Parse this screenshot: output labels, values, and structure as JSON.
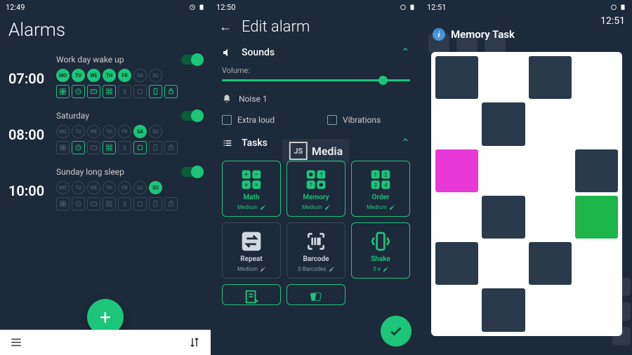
{
  "screen1": {
    "status_time": "12:49",
    "title": "Alarms",
    "alarms": [
      {
        "time": "07:00",
        "name": "Work day wake up",
        "enabled": true,
        "days": [
          {
            "l": "MO",
            "a": true
          },
          {
            "l": "TU",
            "a": true
          },
          {
            "l": "WE",
            "a": true
          },
          {
            "l": "TH",
            "a": true
          },
          {
            "l": "FR",
            "a": true
          },
          {
            "l": "SA",
            "a": false
          },
          {
            "l": "SU",
            "a": false
          }
        ],
        "icons": [
          "a",
          "a",
          "a",
          "a",
          "i",
          "i",
          "a",
          "a"
        ]
      },
      {
        "time": "08:00",
        "name": "Saturday",
        "enabled": true,
        "days": [
          {
            "l": "MO",
            "a": false
          },
          {
            "l": "TU",
            "a": false
          },
          {
            "l": "WE",
            "a": false
          },
          {
            "l": "TH",
            "a": false
          },
          {
            "l": "FR",
            "a": false
          },
          {
            "l": "SA",
            "a": true
          },
          {
            "l": "SU",
            "a": false
          }
        ],
        "icons": [
          "i",
          "a",
          "i",
          "a",
          "i",
          "a",
          "i",
          "i"
        ]
      },
      {
        "time": "10:00",
        "name": "Sunday long sleep",
        "enabled": true,
        "days": [
          {
            "l": "MO",
            "a": false
          },
          {
            "l": "TU",
            "a": false
          },
          {
            "l": "WE",
            "a": false
          },
          {
            "l": "TH",
            "a": false
          },
          {
            "l": "FR",
            "a": false
          },
          {
            "l": "SA",
            "a": false
          },
          {
            "l": "SU",
            "a": true
          }
        ],
        "icons": [
          "i",
          "i",
          "i",
          "i",
          "i",
          "i",
          "i",
          "i"
        ]
      }
    ]
  },
  "screen2": {
    "status_time": "12:50",
    "title": "Edit alarm",
    "sounds_label": "Sounds",
    "volume_label": "Volume:",
    "noise_label": "Noise 1",
    "extra_loud": "Extra loud",
    "vibrations": "Vibrations",
    "tasks_label": "Tasks",
    "tasks": [
      {
        "name": "Math",
        "sub": "Medium",
        "sel": true
      },
      {
        "name": "Memory",
        "sub": "Medium",
        "sel": true
      },
      {
        "name": "Order",
        "sub": "Medium",
        "sel": true
      },
      {
        "name": "Repeat",
        "sub": "Medium",
        "sel": false
      },
      {
        "name": "Barcode",
        "sub": "0 Barcodes",
        "sel": false
      },
      {
        "name": "Shake",
        "sub": "5 s",
        "sel": true
      }
    ],
    "watermark": "Media",
    "watermark_logo": "JS"
  },
  "screen3": {
    "status_time": "12:51",
    "clock_time": "12:51",
    "title": "Memory Task",
    "grid": [
      "d",
      "l",
      "d",
      "l",
      "l",
      "d",
      "l",
      "l",
      "p",
      "l",
      "l",
      "d",
      "l",
      "d",
      "l",
      "g",
      "d",
      "l",
      "d",
      "l",
      "l",
      "d",
      "l",
      "l"
    ]
  }
}
